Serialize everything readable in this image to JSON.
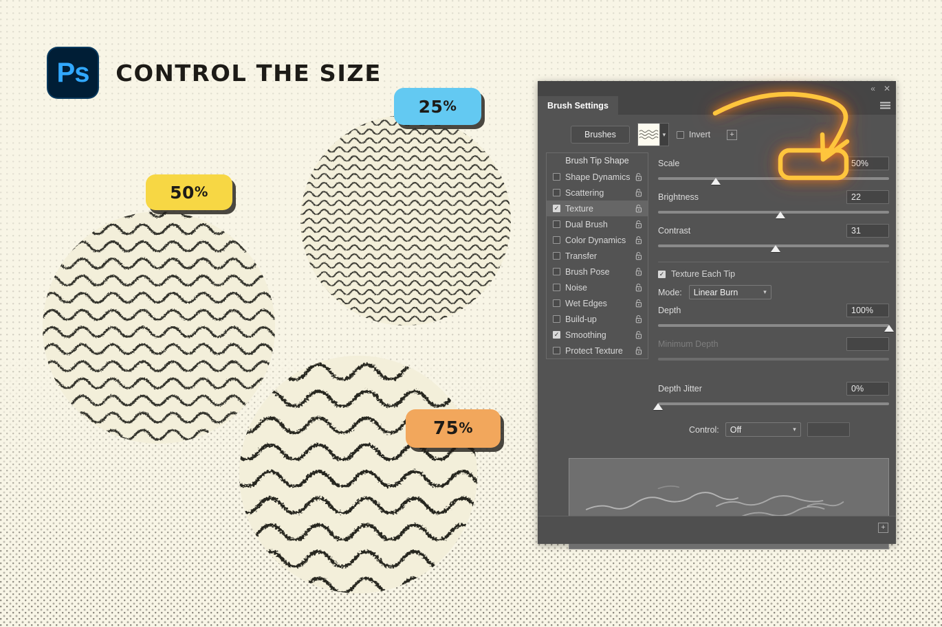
{
  "header": {
    "logo_text": "Ps",
    "logo_name": "photoshop-logo",
    "title": "CONTROL THE SIZE"
  },
  "swatches": [
    {
      "id": "circle-50",
      "badge_label": "50",
      "badge_suffix": "%",
      "badge_color": "#f7d744",
      "scale_percent": 50
    },
    {
      "id": "circle-25",
      "badge_label": "25",
      "badge_suffix": "%",
      "badge_color": "#63c9f2",
      "scale_percent": 25
    },
    {
      "id": "circle-75",
      "badge_label": "75",
      "badge_suffix": "%",
      "badge_color": "#f2a75c",
      "scale_percent": 75
    }
  ],
  "panel": {
    "tab_label": "Brush Settings",
    "window_controls": {
      "collapse": "«",
      "close": "✕"
    },
    "menu_icon": "hamburger-menu-icon",
    "brushes_button": "Brushes",
    "invert_label": "Invert",
    "invert_checked": false,
    "plus_label": "+",
    "options": {
      "header": "Brush Tip Shape",
      "items": [
        {
          "label": "Shape Dynamics",
          "checked": false,
          "selected": false
        },
        {
          "label": "Scattering",
          "checked": false,
          "selected": false
        },
        {
          "label": "Texture",
          "checked": true,
          "selected": true
        },
        {
          "label": "Dual Brush",
          "checked": false,
          "selected": false
        },
        {
          "label": "Color Dynamics",
          "checked": false,
          "selected": false
        },
        {
          "label": "Transfer",
          "checked": false,
          "selected": false
        },
        {
          "label": "Brush Pose",
          "checked": false,
          "selected": false
        },
        {
          "label": "Noise",
          "checked": false,
          "selected": false
        },
        {
          "label": "Wet Edges",
          "checked": false,
          "selected": false
        },
        {
          "label": "Build-up",
          "checked": false,
          "selected": false
        },
        {
          "label": "Smoothing",
          "checked": true,
          "selected": false
        },
        {
          "label": "Protect Texture",
          "checked": false,
          "selected": false
        }
      ]
    },
    "controls": {
      "scale": {
        "label": "Scale",
        "value": "50%",
        "slider_percent": 25,
        "highlighted": true
      },
      "brightness": {
        "label": "Brightness",
        "value": "22",
        "slider_percent": 53
      },
      "contrast": {
        "label": "Contrast",
        "value": "31",
        "slider_percent": 51
      },
      "texture_each_tip": {
        "label": "Texture Each Tip",
        "checked": true
      },
      "mode": {
        "label": "Mode:",
        "value": "Linear Burn"
      },
      "depth": {
        "label": "Depth",
        "value": "100%",
        "slider_percent": 100
      },
      "minimum_depth": {
        "label": "Minimum Depth",
        "value": "",
        "slider_percent": 0,
        "disabled": true
      },
      "depth_jitter": {
        "label": "Depth Jitter",
        "value": "0%",
        "slider_percent": 0
      },
      "control": {
        "label": "Control:",
        "value": "Off"
      }
    },
    "footer": {
      "new_brush_icon": "new-brush-icon",
      "new_brush_label": "+"
    }
  },
  "annotation": {
    "arrow_color": "#ffc53d",
    "glow_color": "#ff7a18",
    "highlight_target": "scale-value-field"
  }
}
